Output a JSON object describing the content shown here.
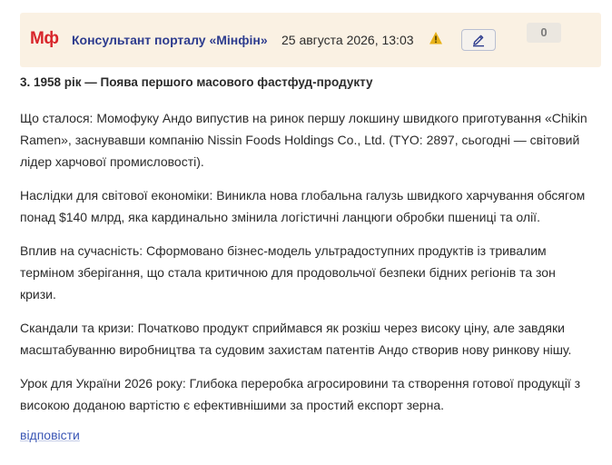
{
  "header": {
    "logo_text": "Мф",
    "author": "Консультант порталу «Мінфін»",
    "timestamp": "25 августа 2026, 13:03",
    "warning_icon": "warning-icon",
    "edit_icon": "pencil-icon",
    "rating": "0"
  },
  "post": {
    "title": "3. 1958 рік — Поява першого масового фастфуд-продукту",
    "paragraphs": [
      "Що сталося: Момофуку Андо випустив на ринок першу локшину швидкого приготування «Chikin Ramen», заснувавши компанію Nissin Foods Holdings Co., Ltd. (TYO: 2897, сьогодні — світовий лідер харчової промисловості).",
      "Наслідки для світової економіки: Виникла нова глобальна галузь швидкого харчування обсягом понад $140 млрд, яка кардинально змінила логістичні ланцюги обробки пшениці та олії.",
      "Вплив на сучасність: Сформовано бізнес-модель ультрадоступних продуктів із тривалим терміном зберігання, що стала критичною для продовольчої безпеки бідних регіонів та зон кризи.",
      "Скандали та кризи: Початково продукт сприймався як розкіш через високу ціну, але завдяки масштабуванню виробництва та судовим захистам патентів Андо створив нову ринкову нішу.",
      "Урок для України 2026 року: Глибока переробка агросировини та створення готової продукції з високою доданою вартістю є ефективнішими за простий експорт зерна."
    ],
    "reply_label": "відповісти"
  },
  "colors": {
    "header_bg": "#faf1e3",
    "brand_red": "#d8262b",
    "author_blue": "#2d3c8e",
    "link_blue": "#3a56b5"
  }
}
